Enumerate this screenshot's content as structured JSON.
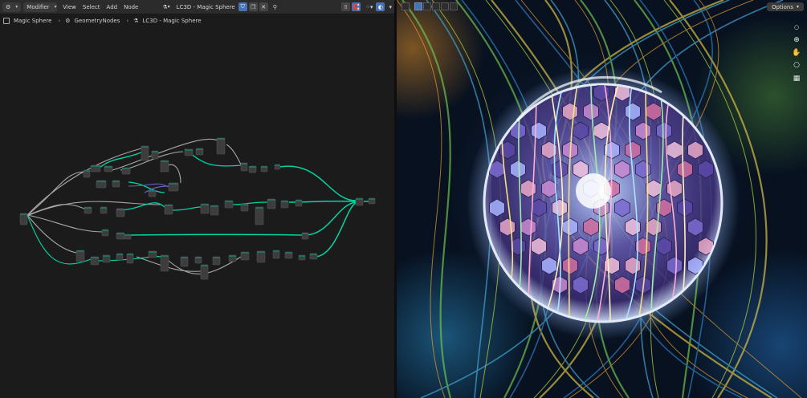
{
  "header": {
    "editor_type_icon": "node-editor-icon",
    "mode_dropdown": "Modifier",
    "menus": [
      "View",
      "Select",
      "Add",
      "Node"
    ],
    "node_group_name": "LC3D - Magic Sphere",
    "pin_icon": "pin-icon"
  },
  "breadcrumb": {
    "items": [
      "Magic Sphere",
      "GeometryNodes",
      "LC3D - Magic Sphere"
    ]
  },
  "viewport": {
    "options_label": "Options",
    "navigation_icons": [
      "zoom-icon",
      "hand-pan-icon",
      "camera-icon",
      "grid-icon"
    ]
  },
  "colors": {
    "geometry_link": "#00d6a3",
    "default_link": "#a9a9a9",
    "vector_link": "#6363c7",
    "accent": "#4772b3"
  }
}
